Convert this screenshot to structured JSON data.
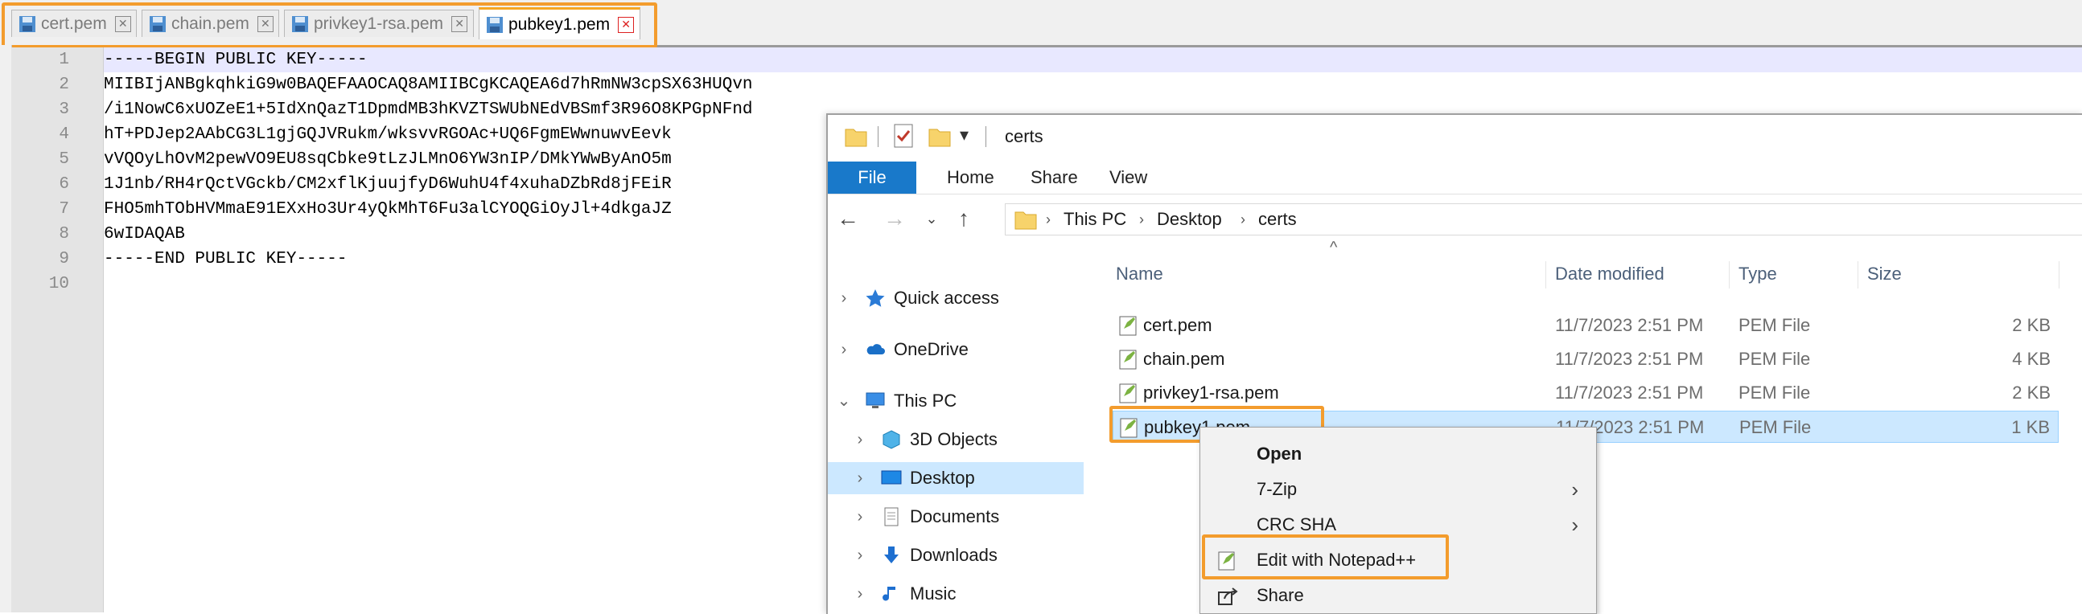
{
  "editor": {
    "tabs": [
      {
        "label": "cert.pem",
        "active": false
      },
      {
        "label": "chain.pem",
        "active": false
      },
      {
        "label": "privkey1-rsa.pem",
        "active": false
      },
      {
        "label": "pubkey1.pem",
        "active": true
      }
    ],
    "line_numbers": [
      "1",
      "2",
      "3",
      "4",
      "5",
      "6",
      "7",
      "8",
      "9",
      "10"
    ],
    "lines": [
      "-----BEGIN PUBLIC KEY-----",
      "MIIBIjANBgkqhkiG9w0BAQEFAAOCAQ8AMIIBCgKCAQEA6d7hRmNW3cpSX63HUQvn",
      "/i1NowC6xUOZeE1+5IdXnQazT1DpmdMB3hKVZTSWUbNEdVBSmf3R96O8KPGpNFnd",
      "hT+PDJep2AAbCG3L1gjGQJVRukm/wksvvRGOAc+UQ6FgmEWwnuwvEevk",
      "vVQOyLhOvM2pewVO9EU8sqCbke9tLzJLMnO6YW3nIP/DMkYWwByAnO5m",
      "1J1nb/RH4rQctVGckb/CM2xflKjuujfyD6WuhU4f4xuhaDZbRd8jFEiR",
      "FHO5mhTObHVMmaE91EXxHo3Ur4yQkMhT6Fu3alCYOQGiOyJl+4dkgaJZ",
      "6wIDAQAB",
      "-----END PUBLIC KEY-----",
      ""
    ]
  },
  "explorer": {
    "title": "certs",
    "ribbon_tabs": [
      "File",
      "Home",
      "Share",
      "View"
    ],
    "breadcrumb": [
      "This PC",
      "Desktop",
      "certs"
    ],
    "nav": [
      {
        "label": "Quick access",
        "icon": "star-icon"
      },
      {
        "label": "OneDrive",
        "icon": "cloud-icon"
      },
      {
        "label": "This PC",
        "icon": "computer-icon"
      },
      {
        "label": "3D Objects",
        "icon": "cube-icon"
      },
      {
        "label": "Desktop",
        "icon": "desktop-icon"
      },
      {
        "label": "Documents",
        "icon": "document-icon"
      },
      {
        "label": "Downloads",
        "icon": "download-icon"
      },
      {
        "label": "Music",
        "icon": "music-icon"
      }
    ],
    "columns": {
      "name": "Name",
      "date": "Date modified",
      "type": "Type",
      "size": "Size"
    },
    "files": [
      {
        "name": "cert.pem",
        "date": "11/7/2023 2:51 PM",
        "type": "PEM File",
        "size": "2 KB"
      },
      {
        "name": "chain.pem",
        "date": "11/7/2023 2:51 PM",
        "type": "PEM File",
        "size": "4 KB"
      },
      {
        "name": "privkey1-rsa.pem",
        "date": "11/7/2023 2:51 PM",
        "type": "PEM File",
        "size": "2 KB"
      },
      {
        "name": "pubkey1.pem",
        "date": "11/7/2023 2:51 PM",
        "type": "PEM File",
        "size": "1 KB"
      }
    ]
  },
  "context_menu": {
    "items": [
      {
        "label": "Open"
      },
      {
        "label": "7-Zip"
      },
      {
        "label": "CRC SHA"
      },
      {
        "label": "Edit with Notepad++"
      },
      {
        "label": "Share"
      }
    ]
  },
  "colors": {
    "highlight": "#f39c2d",
    "ribbon_file": "#1979ca",
    "selection": "#cce8ff"
  }
}
